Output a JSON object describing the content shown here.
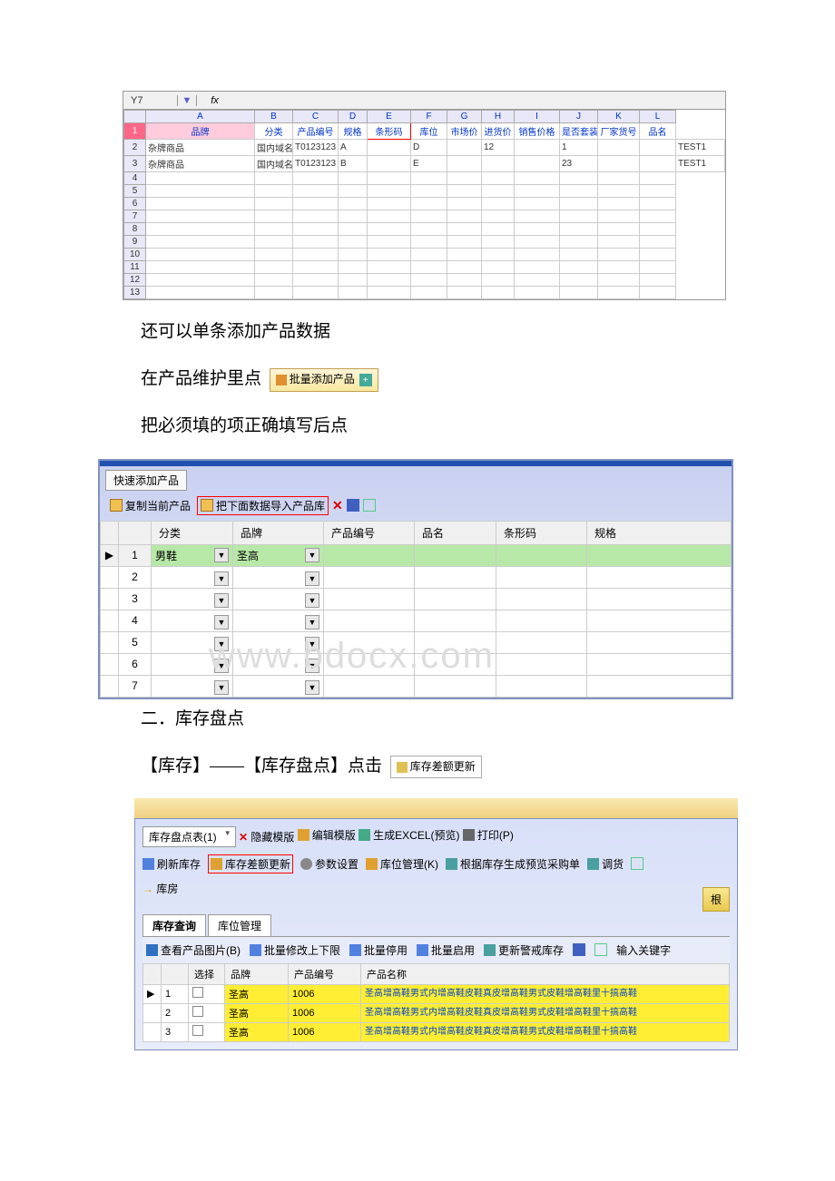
{
  "excel": {
    "cellref": "Y7",
    "fx": "fx",
    "cols": [
      "A",
      "B",
      "C",
      "D",
      "E",
      "F",
      "G",
      "H",
      "I",
      "J",
      "K",
      "L"
    ],
    "headers": [
      "品牌",
      "分类",
      "产品编号",
      "规格",
      "条形码",
      "库位",
      "市场价",
      "进货价",
      "销售价格",
      "是否套装",
      "厂家货号",
      "品名"
    ],
    "rows": [
      {
        "n": "2",
        "cells": [
          "杂牌商品",
          "国内域名",
          "T0123123",
          "A",
          "",
          "D",
          "",
          "12",
          "",
          "1",
          "",
          "",
          "TEST1"
        ]
      },
      {
        "n": "3",
        "cells": [
          "杂牌商品",
          "国内域名",
          "T0123123",
          "B",
          "",
          "E",
          "",
          "",
          "",
          "23",
          "",
          "",
          "TEST1"
        ]
      }
    ],
    "emptyRows": [
      "4",
      "5",
      "6",
      "7",
      "8",
      "9",
      "10",
      "11",
      "12",
      "13"
    ]
  },
  "text": {
    "line1": "还可以单条添加产品数据",
    "line2_pre": "在产品维护里点",
    "btn_bulk_add": "批量添加产品",
    "line3": "把必须填的项正确填写后点",
    "section2": "二．库存盘点",
    "line_inv_pre": "【库存】——【库存盘点】点击",
    "btn_inv_update": "库存差额更新"
  },
  "quickAdd": {
    "tabTitle": "快速添加产品",
    "copy": "复制当前产品",
    "import": "把下面数据导入产品库",
    "headers": [
      "",
      "",
      "分类",
      "品牌",
      "产品编号",
      "品名",
      "条形码",
      "规格"
    ],
    "row1": {
      "category": "男鞋",
      "brand": "圣高"
    },
    "rowCount": 7
  },
  "watermark": "www.bdocx.com",
  "inventory": {
    "dropdown": "库存盘点表(1)",
    "hideTpl": "隐藏模版",
    "editTpl": "编辑模版",
    "genExcel": "生成EXCEL(预览)",
    "print": "打印(P)",
    "refresh": "刷新库存",
    "diffUpdate": "库存差额更新",
    "paramSet": "参数设置",
    "posManage": "库位管理(K)",
    "genPurchase": "根据库存生成预览采购单",
    "transfer": "调货",
    "kufang": "库房",
    "btnRight": "根",
    "tab1": "库存查询",
    "tab2": "库位管理",
    "viewPic": "查看产品图片(B)",
    "batchLimit": "批量修改上下限",
    "batchStop": "批量停用",
    "batchStart": "批量启用",
    "updWarn": "更新警戒库存",
    "keyword": "输入关键字",
    "tableHeaders": [
      "",
      "",
      "选择",
      "品牌",
      "产品编号",
      "产品名称"
    ],
    "rows": [
      {
        "n": "1",
        "brand": "圣高",
        "code": "1006",
        "name": "圣高增高鞋男式内增高鞋皮鞋真皮增高鞋男式皮鞋增高鞋里十搞高鞋"
      },
      {
        "n": "2",
        "brand": "圣高",
        "code": "1006",
        "name": "圣高增高鞋男式内增高鞋皮鞋真皮增高鞋男式皮鞋增高鞋里十搞高鞋"
      },
      {
        "n": "3",
        "brand": "圣高",
        "code": "1006",
        "name": "圣高增高鞋男式内增高鞋皮鞋真皮增高鞋男式皮鞋增高鞋里十搞高鞋"
      }
    ]
  }
}
